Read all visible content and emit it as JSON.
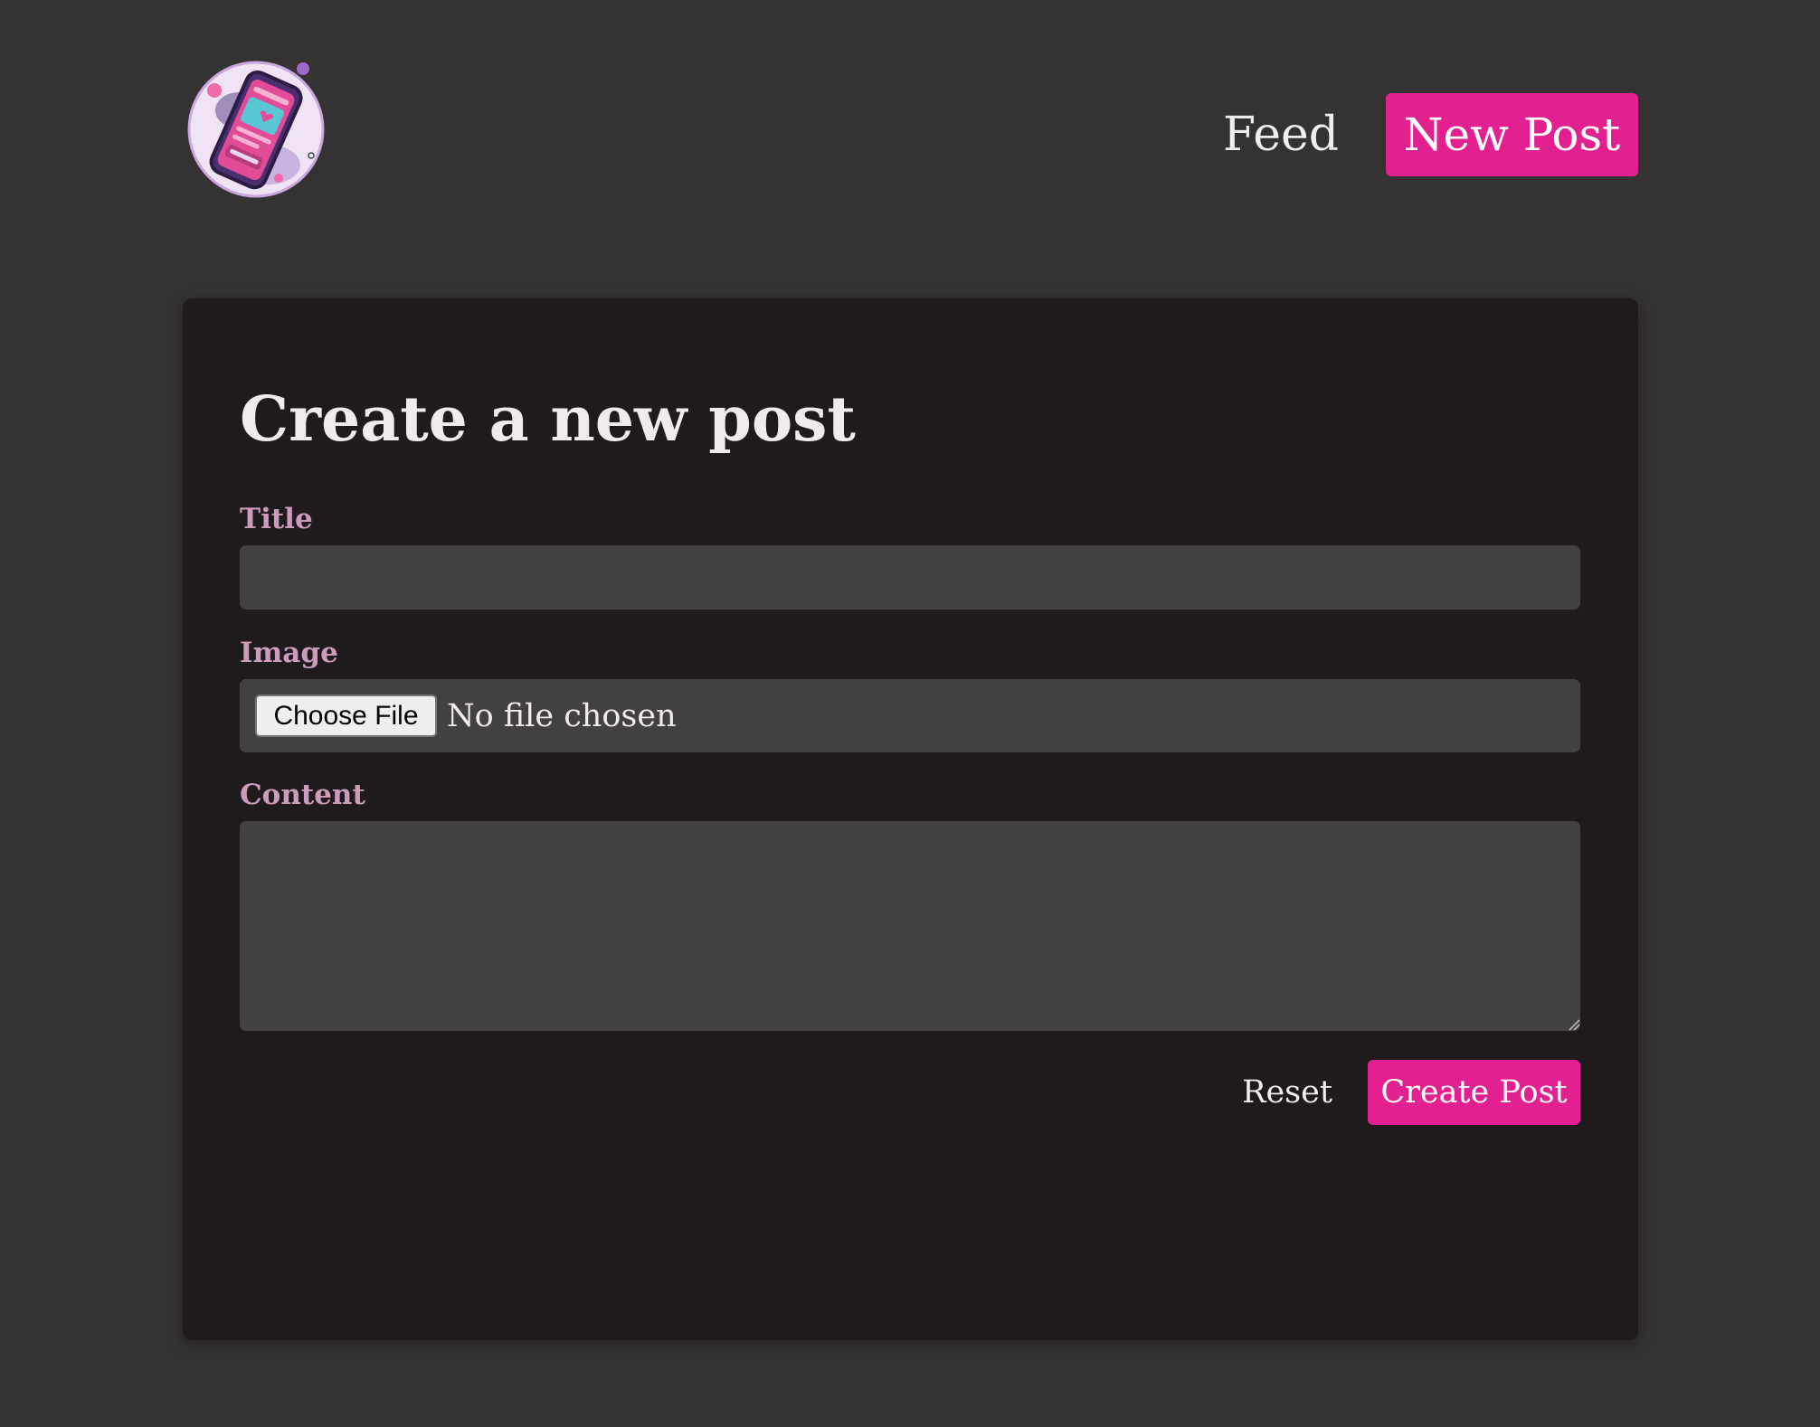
{
  "header": {
    "logo_name": "phone-feed-logo",
    "nav": {
      "feed_label": "Feed",
      "new_post_label": "New Post"
    }
  },
  "form": {
    "title": "Create a new post",
    "fields": {
      "title_label": "Title",
      "title_value": "",
      "title_placeholder": "",
      "image_label": "Image",
      "choose_file_label": "Choose File",
      "file_status": "No file chosen",
      "content_label": "Content",
      "content_value": ""
    },
    "actions": {
      "reset_label": "Reset",
      "submit_label": "Create Post"
    }
  },
  "colors": {
    "page_background": "#353233",
    "card_background": "#1f1b1d",
    "input_background": "#434042",
    "accent": "#e3208f",
    "label_color": "#cc9dbb"
  }
}
